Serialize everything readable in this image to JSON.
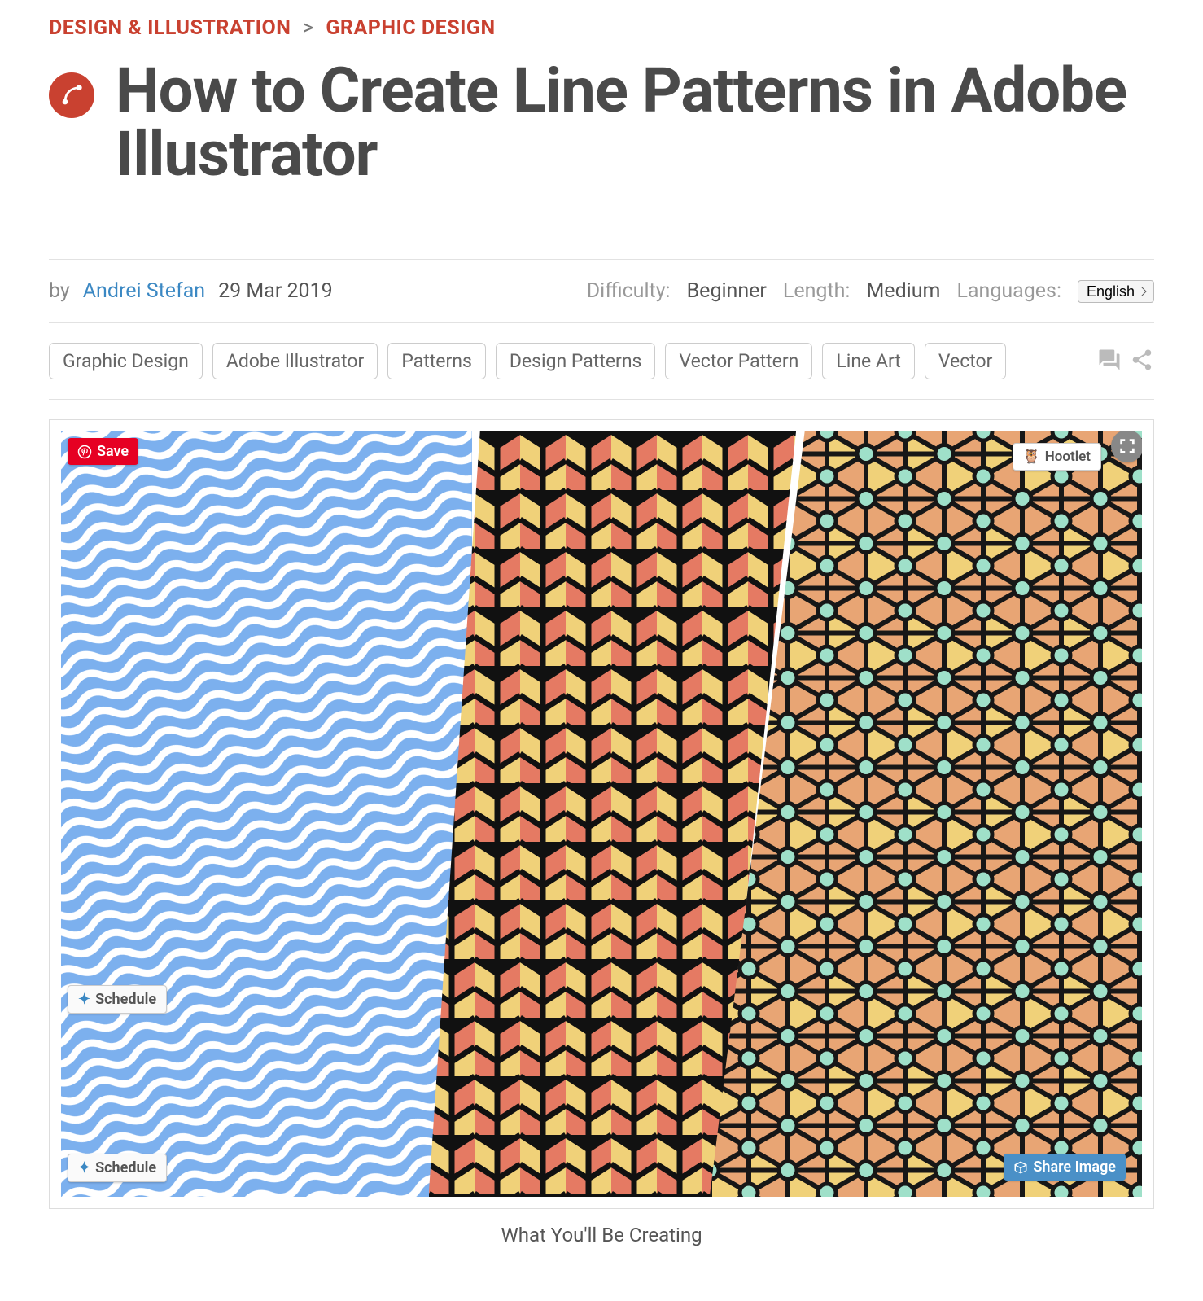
{
  "breadcrumb": {
    "cat": "DESIGN & ILLUSTRATION",
    "sep": ">",
    "sub": "GRAPHIC DESIGN"
  },
  "title": "How to Create Line Patterns in Adobe Illustrator",
  "meta": {
    "by": "by",
    "author": "Andrei Stefan",
    "date": "29 Mar 2019",
    "difficulty_label": "Difficulty:",
    "difficulty_value": "Beginner",
    "length_label": "Length:",
    "length_value": "Medium",
    "languages_label": "Languages:",
    "language_selected": "English"
  },
  "tags": [
    "Graphic Design",
    "Adobe Illustrator",
    "Patterns",
    "Design Patterns",
    "Vector Pattern",
    "Line Art",
    "Vector"
  ],
  "hero": {
    "save": "Save",
    "hootlet": "Hootlet",
    "schedule": "Schedule",
    "share_image": "Share Image",
    "caption": "What You'll Be Creating"
  },
  "colors": {
    "accent": "#c94130",
    "link": "#3b88c3",
    "pin": "#e60023",
    "share": "#4a90c7"
  }
}
